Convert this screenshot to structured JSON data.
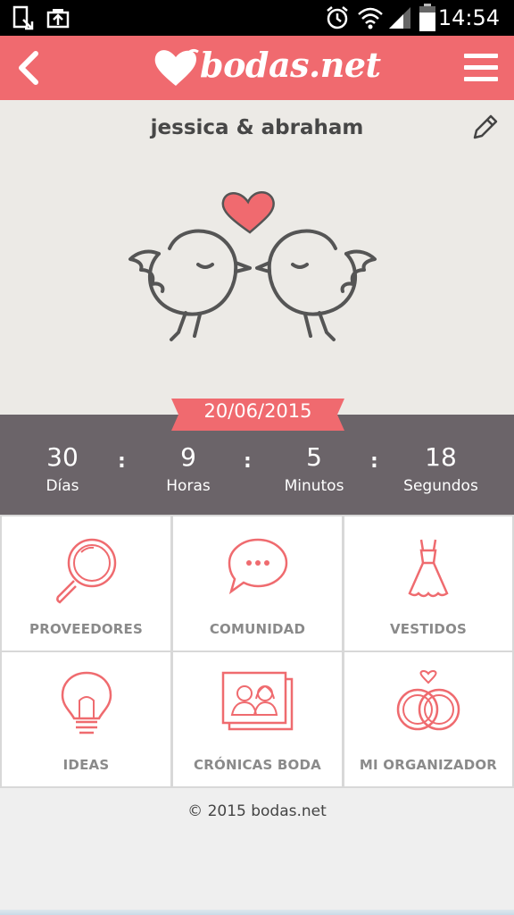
{
  "statusbar": {
    "time": "14:54",
    "icons": [
      "download-icon",
      "upload-icon",
      "alarm-icon",
      "wifi-icon",
      "signal-icon",
      "battery-icon"
    ]
  },
  "appbar": {
    "logo_text": "bodas.net",
    "icons": [
      "back-icon",
      "heart-logo-icon",
      "hamburger-menu-icon"
    ],
    "color": "#f06a6f"
  },
  "hero": {
    "names": "jessica & abraham",
    "icons": [
      "pencil-icon",
      "love-birds-illustration"
    ]
  },
  "countdown": {
    "date": "20/06/2015",
    "items": [
      {
        "value": "30",
        "label": "Días"
      },
      {
        "value": "9",
        "label": "Horas"
      },
      {
        "value": "5",
        "label": "Minutos"
      },
      {
        "value": "18",
        "label": "Segundos"
      }
    ],
    "separator": ":"
  },
  "menu": [
    {
      "label": "PROVEEDORES",
      "icon": "magnifier-icon"
    },
    {
      "label": "COMUNIDAD",
      "icon": "chat-bubble-icon"
    },
    {
      "label": "VESTIDOS",
      "icon": "dress-icon"
    },
    {
      "label": "IDEAS",
      "icon": "lightbulb-icon"
    },
    {
      "label": "CRÓNICAS BODA",
      "icon": "photo-couple-icon"
    },
    {
      "label": "MI ORGANIZADOR",
      "icon": "rings-icon"
    }
  ],
  "footer": {
    "copyright": "© 2015 bodas.net"
  },
  "colors": {
    "accent": "#f06a6f",
    "countdown_bg": "#6b6469",
    "hero_bg": "#eceae6",
    "icon_stroke": "#ef6b6f"
  }
}
